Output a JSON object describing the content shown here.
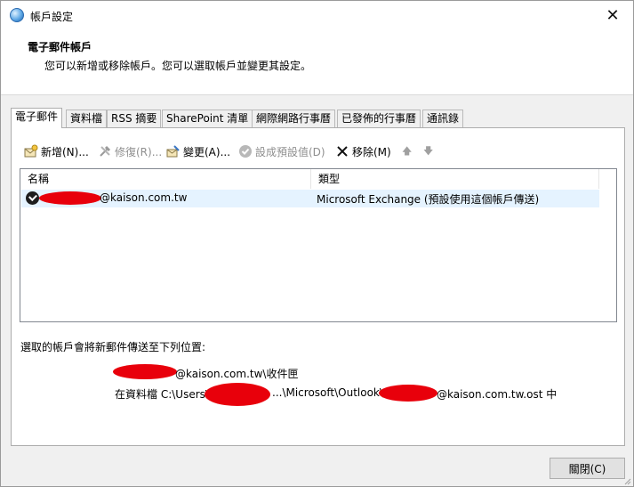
{
  "window": {
    "title": "帳戶設定",
    "close_glyph": "✕"
  },
  "header": {
    "title": "電子郵件帳戶",
    "subtitle": "您可以新增或移除帳戶。您可以選取帳戶並變更其設定。"
  },
  "tabs": [
    {
      "label": "電子郵件",
      "active": true
    },
    {
      "label": "資料檔",
      "active": false
    },
    {
      "label": "RSS 摘要",
      "active": false
    },
    {
      "label": "SharePoint 清單",
      "active": false
    },
    {
      "label": "網際網路行事曆",
      "active": false
    },
    {
      "label": "已發佈的行事曆",
      "active": false
    },
    {
      "label": "通訊錄",
      "active": false
    }
  ],
  "toolbar": {
    "new_label": "新增(N)...",
    "repair_label": "修復(R)...",
    "change_label": "變更(A)...",
    "set_default_label": "設成預設值(D)",
    "remove_label": "移除(M)",
    "up_arrow": "🡅",
    "down_arrow": "🡇"
  },
  "list": {
    "columns": [
      "名稱",
      "類型"
    ],
    "rows": [
      {
        "name": "@kaison.com.tw",
        "type": "Microsoft Exchange (預設使用這個帳戶傳送)"
      }
    ]
  },
  "delivery": {
    "label": "選取的帳戶會將新郵件傳送至下列位置:",
    "mailbox": "@kaison.com.tw\\收件匣",
    "path_prefix": "在資料檔 C:\\Users\\",
    "path_middle": "...\\Microsoft\\Outlook\\",
    "path_suffix": "@kaison.com.tw.ost 中"
  },
  "footer": {
    "close_label": "關閉(C)"
  },
  "colors": {
    "redaction": "#e8000b",
    "selected_row": "#e5f3ff",
    "disabled_text": "#8f8f8f"
  }
}
